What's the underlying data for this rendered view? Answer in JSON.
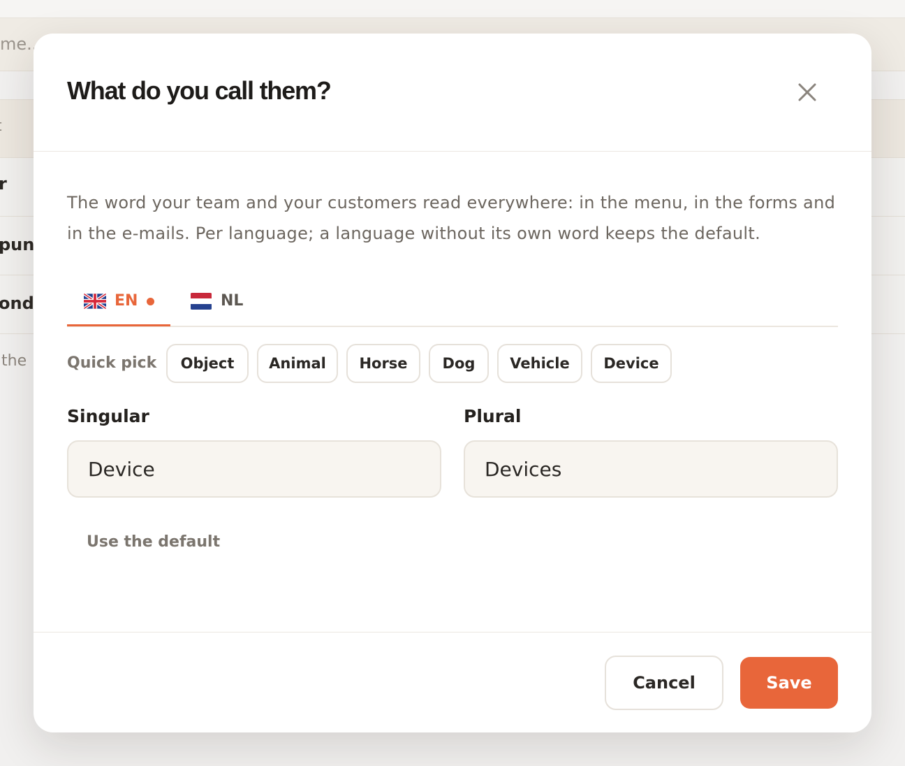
{
  "background": {
    "search_text": "me...",
    "table_header_text": "t",
    "rows": [
      {
        "text": "r"
      },
      {
        "text": "pun"
      },
      {
        "text": "ondi"
      }
    ],
    "footer_text": "the"
  },
  "modal": {
    "title": "What do you call them?",
    "close_icon": "close-icon",
    "intro": "The word your team and your customers read everywhere: in the menu, in the forms and in the e-mails. Per language; a language without its own word keeps the default.",
    "tabs": [
      {
        "label": "EN",
        "flag": "uk-flag-icon",
        "active": true,
        "has_changes": true
      },
      {
        "label": "NL",
        "flag": "nl-flag-icon",
        "active": false,
        "has_changes": false
      }
    ],
    "quick_pick": {
      "label": "Quick pick",
      "options": [
        "Object",
        "Animal",
        "Horse",
        "Dog",
        "Vehicle",
        "Device"
      ]
    },
    "singular": {
      "label": "Singular",
      "value": "Device"
    },
    "plural": {
      "label": "Plural",
      "value": "Devices"
    },
    "use_default_label": "Use the default",
    "cancel_label": "Cancel",
    "save_label": "Save"
  },
  "colors": {
    "accent": "#e8663a",
    "field_bg": "#f8f5f0",
    "border": "#e6e1da"
  }
}
